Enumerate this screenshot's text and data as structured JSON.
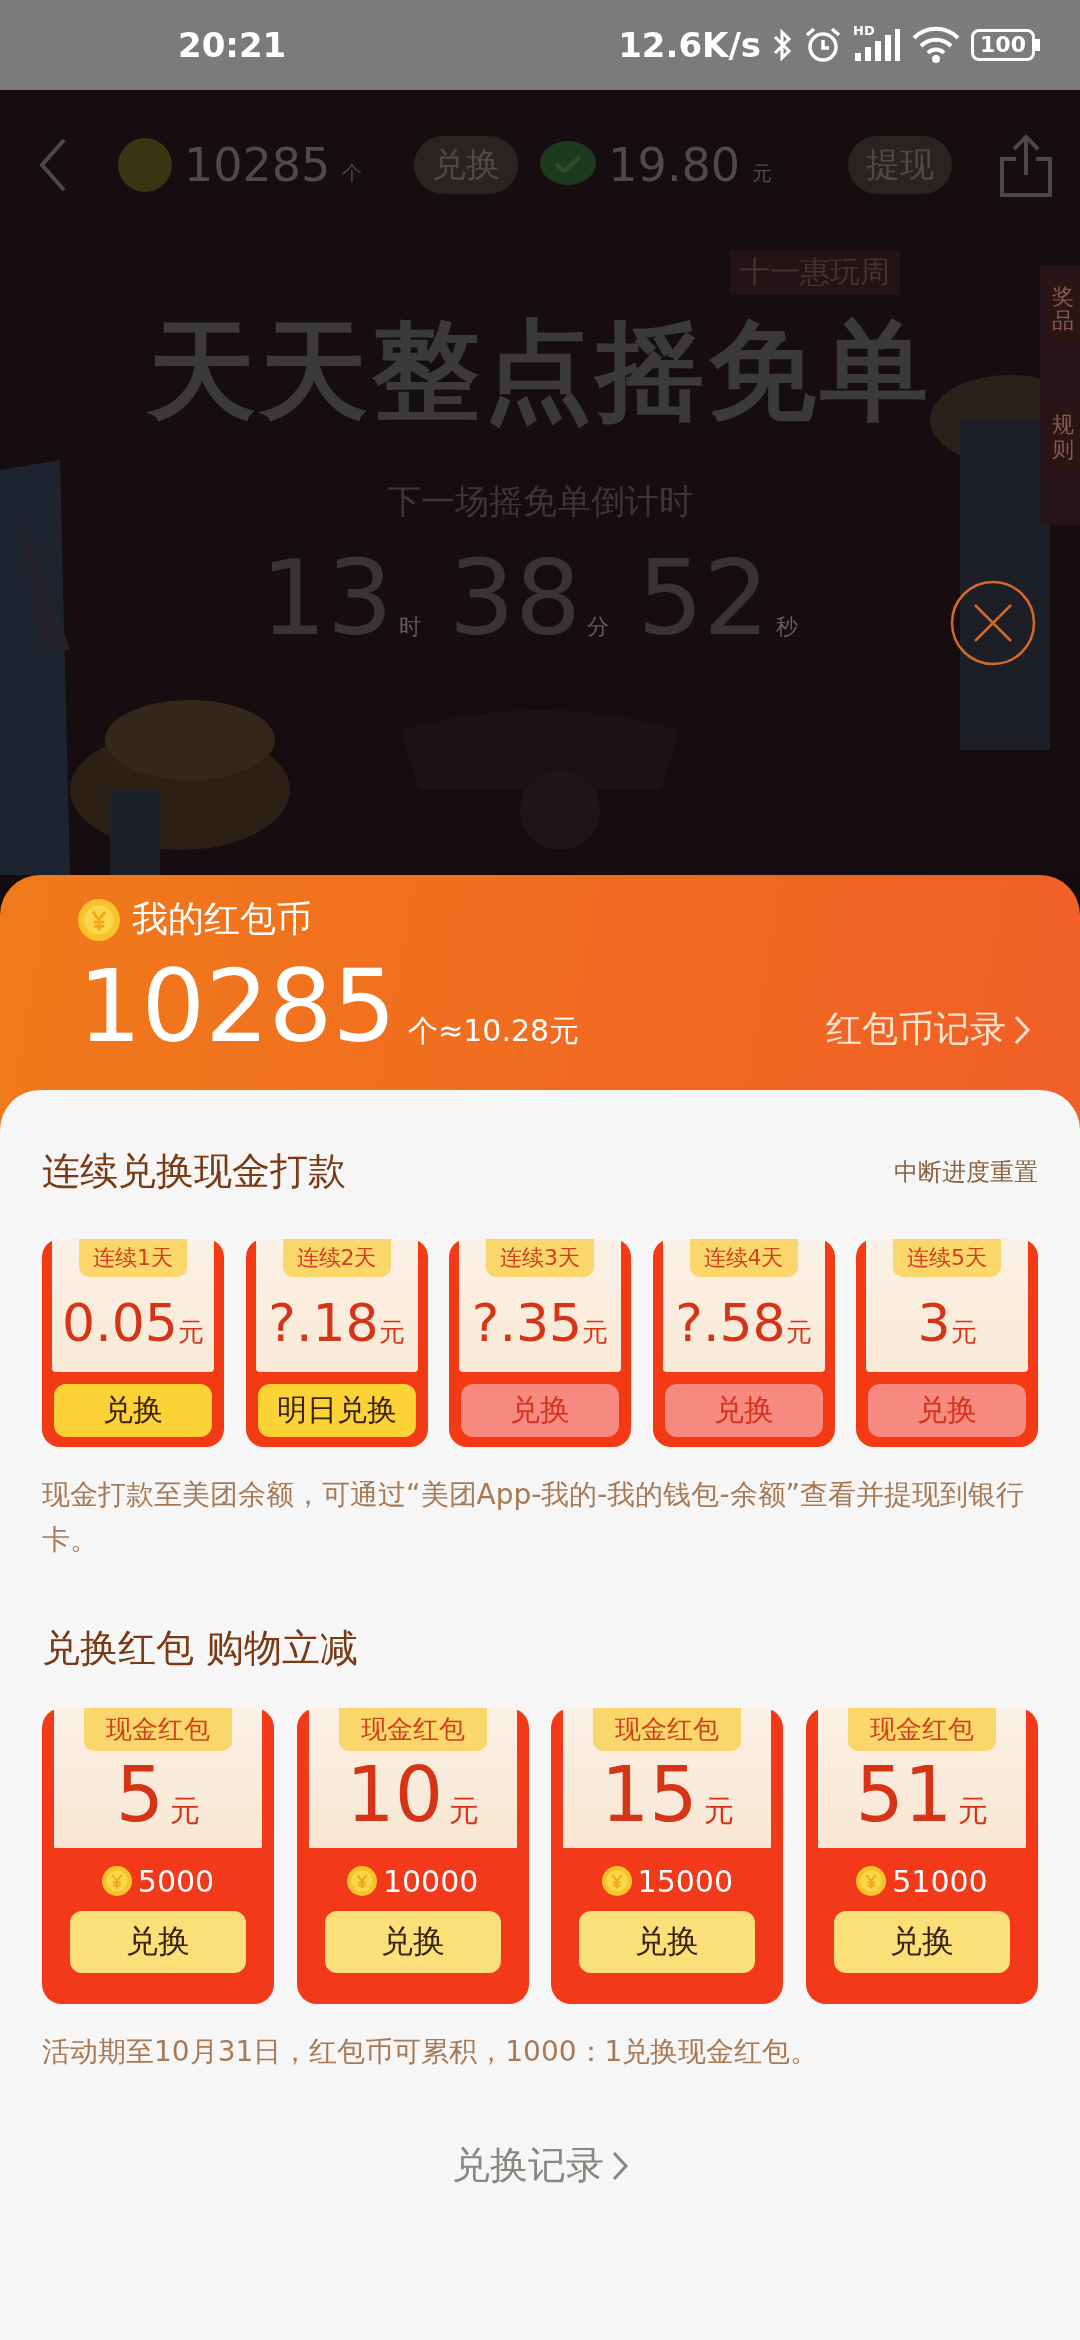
{
  "status_bar": {
    "time": "20:21",
    "net_speed": "12.6K/s",
    "signal_tag": "HD",
    "battery": "100"
  },
  "top_bar": {
    "coins": "10285",
    "coins_unit": "个",
    "exchange_button": "兑换",
    "cash": "19.80",
    "cash_unit": "元",
    "withdraw_button": "提现"
  },
  "banner": {
    "tag": "十一惠玩周",
    "title": "天天整点摇免单",
    "countdown_label": "下一场摇免单倒计时",
    "countdown": [
      {
        "value": "13",
        "unit": "时"
      },
      {
        "value": "38",
        "unit": "分"
      },
      {
        "value": "52",
        "unit": "秒"
      }
    ],
    "side_tabs": [
      "奖品",
      "规则"
    ]
  },
  "sheet": {
    "title": "我的红包币",
    "balance": "10285",
    "balance_note": "个≈10.28元",
    "record_link": "红包币记录",
    "streak": {
      "title": "连续兑换现金打款",
      "reset_note": "中断进度重置",
      "days": [
        {
          "label": "连续1天",
          "amount": "0.05",
          "unit": "元",
          "button": "兑换",
          "disabled": false
        },
        {
          "label": "连续2天",
          "amount": "?.18",
          "unit": "元",
          "button": "明日兑换",
          "disabled": false
        },
        {
          "label": "连续3天",
          "amount": "?.35",
          "unit": "元",
          "button": "兑换",
          "disabled": true
        },
        {
          "label": "连续4天",
          "amount": "?.58",
          "unit": "元",
          "button": "兑换",
          "disabled": true
        },
        {
          "label": "连续5天",
          "amount": "3",
          "unit": "元",
          "button": "兑换",
          "disabled": true
        }
      ],
      "note": "现金打款至美团余额，可通过“美团App-我的-我的钱包-余额”查看并提现到银行卡。"
    },
    "packets": {
      "title": "兑换红包 购物立减",
      "items": [
        {
          "label": "现金红包",
          "amount": "5",
          "unit": "元",
          "cost": "5000",
          "button": "兑换"
        },
        {
          "label": "现金红包",
          "amount": "10",
          "unit": "元",
          "cost": "10000",
          "button": "兑换"
        },
        {
          "label": "现金红包",
          "amount": "15",
          "unit": "元",
          "cost": "15000",
          "button": "兑换"
        },
        {
          "label": "现金红包",
          "amount": "51",
          "unit": "元",
          "cost": "51000",
          "button": "兑换"
        }
      ],
      "note": "活动期至10月31日，红包币可累积，1000：1兑换现金红包。"
    },
    "history_link": "兑换记录"
  }
}
